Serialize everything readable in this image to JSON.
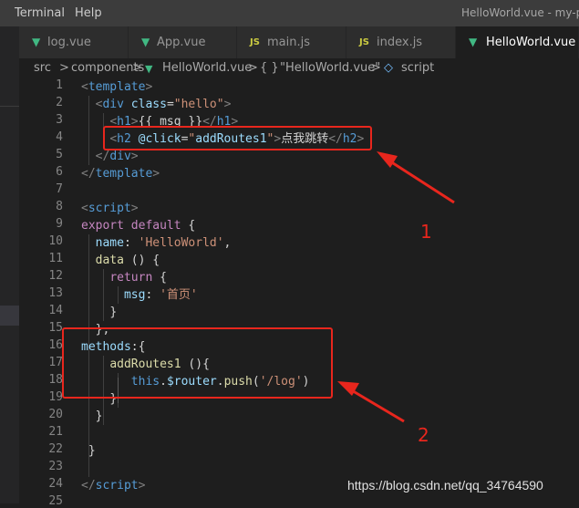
{
  "menubar": {
    "items": [
      "Terminal",
      "Help"
    ]
  },
  "window_title": "HelloWorld.vue - my-pro",
  "tabs": [
    {
      "label": "log.vue",
      "icon": "vue-icon"
    },
    {
      "label": "App.vue",
      "icon": "vue-icon"
    },
    {
      "label": "main.js",
      "icon": "js-icon",
      "icon_text": "JS"
    },
    {
      "label": "index.js",
      "icon": "js-icon",
      "icon_text": "JS"
    },
    {
      "label": "HelloWorld.vue",
      "icon": "vue-icon",
      "active": true
    }
  ],
  "breadcrumb": {
    "items": [
      "src",
      "components",
      "HelloWorld.vue",
      "\"HelloWorld.vue\"",
      "script"
    ],
    "separator": ">",
    "braces_icon": "{ }"
  },
  "line_numbers": [
    "1",
    "2",
    "3",
    "4",
    "5",
    "6",
    "7",
    "8",
    "9",
    "10",
    "11",
    "12",
    "13",
    "14",
    "15",
    "16",
    "17",
    "18",
    "19",
    "20",
    "21",
    "22",
    "23",
    "24",
    "25"
  ],
  "annotations": {
    "label_1": "1",
    "label_2": "2"
  },
  "watermark": "https://blog.csdn.net/qq_34764590",
  "colors": {
    "annotation_red": "#e8261d",
    "editor_bg": "#1e1e1e",
    "vue_green": "#41b883"
  }
}
